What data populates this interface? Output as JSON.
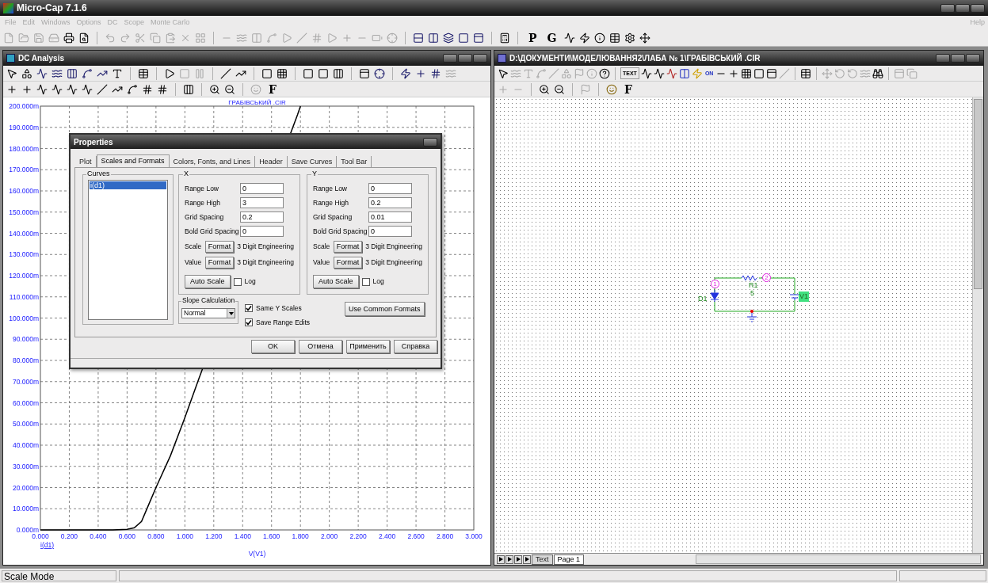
{
  "window": {
    "title": "Micro-Cap 7.1.6"
  },
  "menu": [
    {
      "label": "File",
      "disabled": true
    },
    {
      "label": "Edit",
      "disabled": true
    },
    {
      "label": "Windows",
      "disabled": true
    },
    {
      "label": "Options",
      "disabled": true
    },
    {
      "label": "DC",
      "disabled": true
    },
    {
      "label": "Scope",
      "disabled": true
    },
    {
      "label": "Monte Carlo",
      "disabled": true
    }
  ],
  "menu_right": {
    "label": "Help",
    "disabled": true
  },
  "main_toolbar_text_buttons": [
    "P",
    "G"
  ],
  "dc_window": {
    "title": "DC Analysis",
    "toolbar_text_button": "F",
    "plot": {
      "chart_data": {
        "type": "line",
        "title": "ГРАБІВСЬКИЙ .CIR",
        "xlabel": "V(V1)",
        "x": [
          0,
          0.5,
          0.6,
          0.65,
          0.7,
          0.75,
          0.8,
          0.9,
          1.0,
          1.1,
          1.78,
          1.8
        ],
        "series": [
          {
            "name": "i(d1)",
            "color": "#000000",
            "values": [
              0,
              0,
              0.3,
              1,
              4,
              12,
              20,
              35,
              53,
              72,
              196,
              200
            ]
          }
        ],
        "xlim": [
          0,
          3
        ],
        "ylim": [
          0,
          200
        ],
        "grid": true,
        "xticks": [
          {
            "value": 0,
            "label": "0.000"
          },
          {
            "value": 0.2,
            "label": "0.200"
          },
          {
            "value": 0.4,
            "label": "0.400"
          },
          {
            "value": 0.6,
            "label": "0.600"
          },
          {
            "value": 0.8,
            "label": "0.800"
          },
          {
            "value": 1.0,
            "label": "1.000"
          },
          {
            "value": 1.2,
            "label": "1.200"
          },
          {
            "value": 1.4,
            "label": "1.400"
          },
          {
            "value": 1.6,
            "label": "1.600"
          },
          {
            "value": 1.8,
            "label": "1.800"
          },
          {
            "value": 2.0,
            "label": "2.000"
          },
          {
            "value": 2.2,
            "label": "2.200"
          },
          {
            "value": 2.4,
            "label": "2.400"
          },
          {
            "value": 2.6,
            "label": "2.600"
          },
          {
            "value": 2.8,
            "label": "2.800"
          },
          {
            "value": 3.0,
            "label": "3.000"
          }
        ],
        "yticks": [
          {
            "value": 0,
            "label": "0.000m"
          },
          {
            "value": 10,
            "label": "10.000m"
          },
          {
            "value": 20,
            "label": "20.000m"
          },
          {
            "value": 30,
            "label": "30.000m"
          },
          {
            "value": 40,
            "label": "40.000m"
          },
          {
            "value": 50,
            "label": "50.000m"
          },
          {
            "value": 60,
            "label": "60.000m"
          },
          {
            "value": 70,
            "label": "70.000m"
          },
          {
            "value": 80,
            "label": "80.000m"
          },
          {
            "value": 90,
            "label": "90.000m"
          },
          {
            "value": 100,
            "label": "100.000m"
          },
          {
            "value": 110,
            "label": "110.000m"
          },
          {
            "value": 120,
            "label": "120.000m"
          },
          {
            "value": 130,
            "label": "130.000m"
          },
          {
            "value": 140,
            "label": "140.000m"
          },
          {
            "value": 150,
            "label": "150.000m"
          },
          {
            "value": 160,
            "label": "160.000m"
          },
          {
            "value": 170,
            "label": "170.000m"
          },
          {
            "value": 180,
            "label": "180.000m"
          },
          {
            "value": 190,
            "label": "190.000m"
          },
          {
            "value": 200,
            "label": "200.000m"
          }
        ]
      }
    }
  },
  "dialog": {
    "title": "Properties",
    "tabs": [
      {
        "label": "Plot",
        "selected": false
      },
      {
        "label": "Scales and Formats",
        "selected": true
      },
      {
        "label": "Colors, Fonts, and Lines",
        "selected": false
      },
      {
        "label": "Header",
        "selected": false
      },
      {
        "label": "Save Curves",
        "selected": false
      },
      {
        "label": "Tool Bar",
        "selected": false
      }
    ],
    "curves": {
      "label": "Curves",
      "items": [
        {
          "label": "i(d1)",
          "selected": true
        }
      ]
    },
    "axes": [
      {
        "label": "X",
        "fields": [
          {
            "label": "Range Low",
            "value": "0"
          },
          {
            "label": "Range High",
            "value": "3"
          },
          {
            "label": "Grid Spacing",
            "value": "0.2"
          },
          {
            "label": "Bold Grid Spacing",
            "value": "0"
          }
        ],
        "formats": [
          {
            "label": "Scale",
            "button": "Format",
            "value": "3 Digit Engineering"
          },
          {
            "label": "Value",
            "button": "Format",
            "value": "3 Digit Engineering"
          }
        ],
        "auto_scale": "Auto Scale",
        "log": {
          "label": "Log",
          "checked": false
        }
      },
      {
        "label": "Y",
        "fields": [
          {
            "label": "Range Low",
            "value": "0"
          },
          {
            "label": "Range High",
            "value": "0.2"
          },
          {
            "label": "Grid Spacing",
            "value": "0.01"
          },
          {
            "label": "Bold Grid Spacing",
            "value": "0"
          }
        ],
        "formats": [
          {
            "label": "Scale",
            "button": "Format",
            "value": "3 Digit Engineering"
          },
          {
            "label": "Value",
            "button": "Format",
            "value": "3 Digit Engineering"
          }
        ],
        "auto_scale": "Auto Scale",
        "log": {
          "label": "Log",
          "checked": false
        }
      }
    ],
    "slope": {
      "label": "Slope Calculation",
      "value": "Normal"
    },
    "checkboxes": [
      {
        "label": "Same Y Scales",
        "checked": true
      },
      {
        "label": "Save Range Edits",
        "checked": true
      }
    ],
    "common_formats": "Use Common Formats",
    "buttons": [
      "OK",
      "Отмена",
      "Применить",
      "Справка"
    ]
  },
  "schematic_window": {
    "title": "D:\\ДОКУМЕНТИ\\МОДЕЛЮВАННЯ2\\ЛАБА № 1\\ГРАБІВСЬКИЙ .CIR",
    "toolbar_labels": [
      "TEXT",
      "ON"
    ],
    "toolbar_text_button": "F",
    "circuit": {
      "nodes": [
        "1",
        "2"
      ],
      "components": [
        {
          "name": "D1"
        },
        {
          "name": "R1",
          "value": "5"
        },
        {
          "name": "V1"
        }
      ]
    },
    "page_tabs": [
      {
        "label": "Text",
        "selected": false
      },
      {
        "label": "Page 1",
        "selected": true
      }
    ]
  },
  "status_bar": {
    "text": "Scale Mode"
  }
}
